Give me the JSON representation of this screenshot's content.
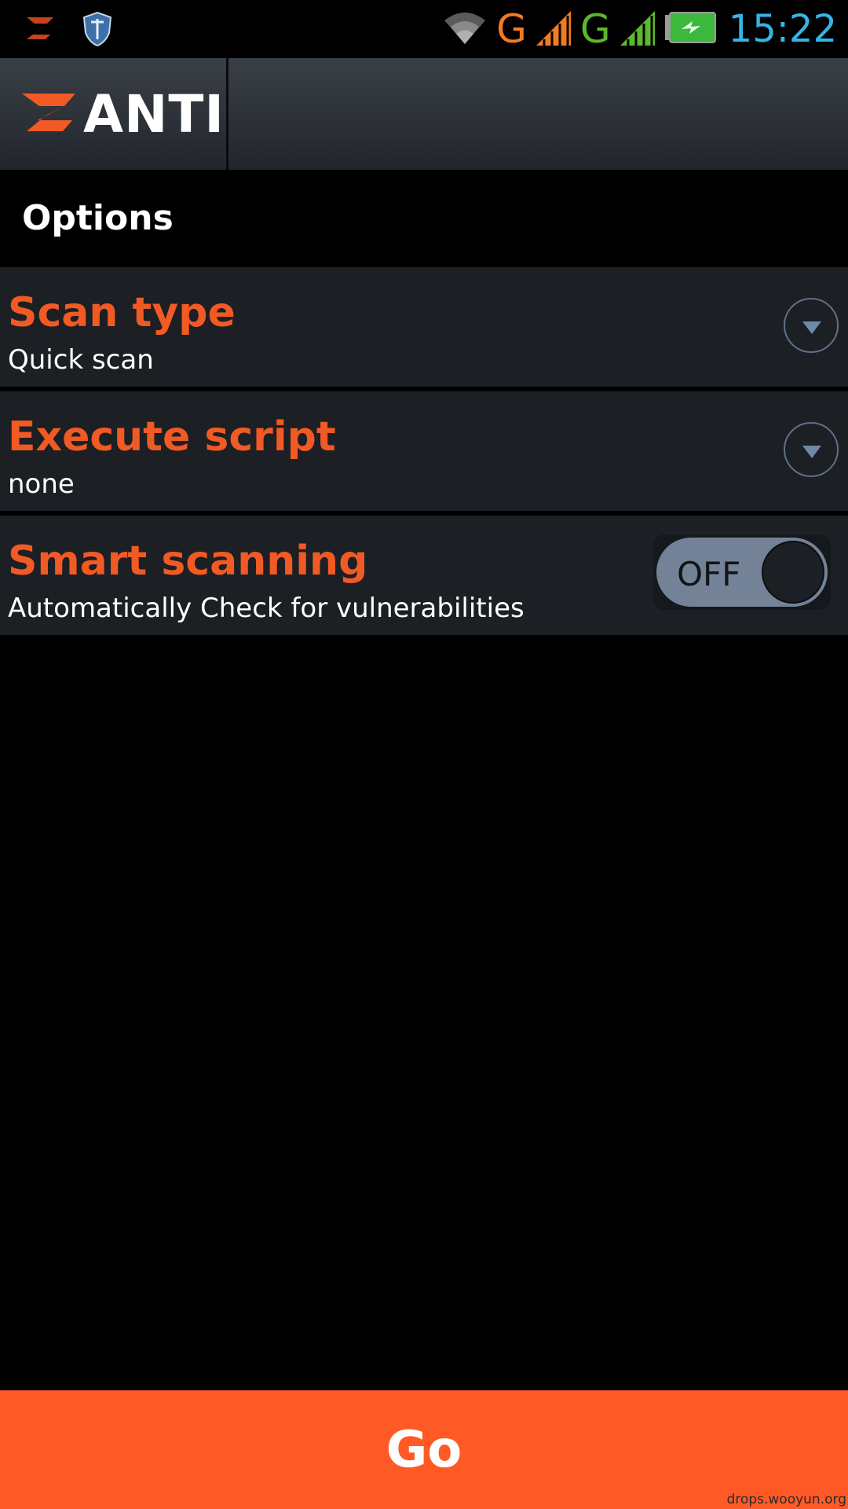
{
  "status_bar": {
    "time": "15:22",
    "network1_label": "G",
    "network2_label": "G",
    "icons": [
      "app-notification-icon",
      "shield-notification-icon",
      "wifi-icon",
      "signal-icon",
      "battery-charging-icon"
    ],
    "colors": {
      "network1": "#f47a20",
      "network2": "#5cb82c",
      "clock": "#35b5e5"
    }
  },
  "action_bar": {
    "app_name": "ANTI"
  },
  "options": {
    "title": "Options"
  },
  "rows": {
    "scan_type": {
      "title": "Scan type",
      "value": "Quick scan"
    },
    "execute_script": {
      "title": "Execute script",
      "value": "none"
    },
    "smart_scanning": {
      "title": "Smart scanning",
      "subtitle": "Automatically Check for vulnerabilities",
      "toggle_label": "OFF",
      "enabled": false
    }
  },
  "go_button": {
    "label": "Go"
  },
  "watermark": "drops.wooyun.org",
  "colors": {
    "accent": "#ff5a26",
    "row_title": "#f15a24",
    "row_bg": "#1c1f23"
  }
}
